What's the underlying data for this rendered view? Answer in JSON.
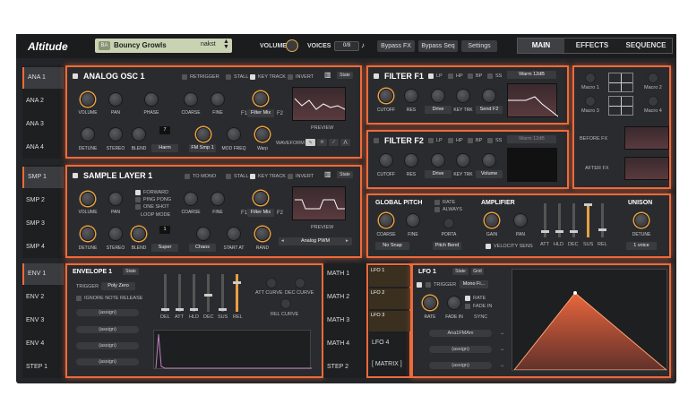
{
  "app": {
    "title": "Altitude"
  },
  "preset": {
    "tag": "BA",
    "name": "Bouncy Growls",
    "author": "nakst"
  },
  "top": {
    "volume": "VOLUME",
    "voices_label": "VOICES",
    "voices": "0/8",
    "bypass_fx": "Bypass FX",
    "bypass_seq": "Bypass Seq",
    "settings": "Settings"
  },
  "tabs": [
    "MAIN",
    "EFFECTS",
    "SEQUENCE"
  ],
  "osc_tabs": [
    "ANA 1",
    "ANA 2",
    "ANA 3",
    "ANA 4"
  ],
  "smp_tabs": [
    "SMP 1",
    "SMP 2",
    "SMP 3",
    "SMP 4"
  ],
  "env_tabs": [
    "ENV 1",
    "ENV 2",
    "ENV 3",
    "ENV 4",
    "STEP 1"
  ],
  "math_tabs": [
    "MATH 1",
    "MATH 2",
    "MATH 3",
    "MATH 4",
    "STEP 2"
  ],
  "lfo_tabs": [
    "LFO 1",
    "LFO 2",
    "LFO 3",
    "LFO 4",
    "[ MATRIX ]"
  ],
  "osc": {
    "title": "ANALOG OSC 1",
    "state": "State",
    "opts": [
      "RETRIGGER",
      "STALL",
      "KEY TRACK",
      "INVERT"
    ],
    "knobs": [
      "VOLUME",
      "PAN",
      "PHASE",
      "COARSE",
      "FINE",
      "DETUNE",
      "STEREO",
      "BLEND",
      "MOD FREQ",
      "Warp"
    ],
    "harm_val": "7",
    "harm": "Harm",
    "fm": "FM Smp 1",
    "filter_mix": "Filter Mix",
    "f1": "F1",
    "f2": "F2",
    "preview": "PREVIEW",
    "waveform": "WAVEFORM"
  },
  "smp": {
    "title": "SAMPLE LAYER 1",
    "state": "State",
    "opts": [
      "TO MONO",
      "STALL",
      "KEY TRACK",
      "INVERT"
    ],
    "knobs": [
      "VOLUME",
      "PAN",
      "COARSE",
      "FINE",
      "DETUNE",
      "STEREO",
      "BLEND",
      "START AT",
      "RAND"
    ],
    "loop": [
      "FORWARD",
      "PING PONG",
      "ONE SHOT"
    ],
    "loop_mode": "LOOP MODE",
    "super_val": "1",
    "super": "Super",
    "chaos": "Chaos",
    "filter_mix": "Filter Mix",
    "f1": "F1",
    "f2": "F2",
    "preview": "PREVIEW",
    "sample": "Analog PWM"
  },
  "f1": {
    "title": "FILTER F1",
    "opts": [
      "LP",
      "HP",
      "BP",
      "SS"
    ],
    "type": "Warm 12dB",
    "knobs": [
      "CUTOFF",
      "RES",
      "Drive",
      "KEY TRK",
      "Send F2"
    ]
  },
  "f2": {
    "title": "FILTER F2",
    "opts": [
      "LP",
      "HP",
      "BP",
      "SS"
    ],
    "type": "Warm 12dB",
    "knobs": [
      "CUTOFF",
      "RES",
      "Drive",
      "KEY TRK",
      "Volume"
    ]
  },
  "macros": [
    "Macro 1",
    "Macro 2",
    "Macro 3",
    "Macro 4"
  ],
  "fx": {
    "before": "BEFORE FX",
    "after": "AFTER FX"
  },
  "pitch": {
    "title": "GLOBAL PITCH",
    "rate": "RATE",
    "always": "ALWAYS",
    "coarse": "COARSE",
    "fine": "FINE",
    "porta": "PORTA",
    "snap": "No Snap",
    "bend": "Pitch Bend"
  },
  "amp": {
    "title": "AMPLIFIER",
    "gain": "GAIN",
    "pan": "PAN",
    "vel": "VELOCITY SENS",
    "sliders": [
      "ATT",
      "HLD",
      "DEC",
      "SUS",
      "REL"
    ]
  },
  "unison": {
    "title": "UNISON",
    "detune": "DETUNE",
    "voices": "1 voice"
  },
  "env": {
    "title": "ENVELOPE 1",
    "state": "State",
    "trigger": "TRIGGER",
    "trig_val": "Poly Zero",
    "ignore": "IGNORE NOTE RELEASE",
    "assign": [
      "(assign)",
      "(assign)",
      "(assign)",
      "(assign)",
      "(assign)"
    ],
    "sliders": [
      "DEL",
      "ATT",
      "HLD",
      "DEC",
      "SUS",
      "REL"
    ],
    "att_curve": "ATT CURVE",
    "dec_curve": "DEC CURVE",
    "rel_curve": "REL CURVE"
  },
  "lfo": {
    "title": "LFO 1",
    "state": "State",
    "grid": "Grid",
    "trigger": "TRIGGER",
    "trig_val": "Mono Fi...",
    "rate_opt": "RATE",
    "fade_opt": "FADE IN",
    "rate": "RATE",
    "fade": "FADE IN",
    "sync": "SYNC",
    "target": "Ana1FMAm",
    "assign": [
      "(assign)",
      "(assign)"
    ]
  },
  "colors": {
    "accent": "#ee6a3a",
    "knob_ring": "#e8a040"
  }
}
